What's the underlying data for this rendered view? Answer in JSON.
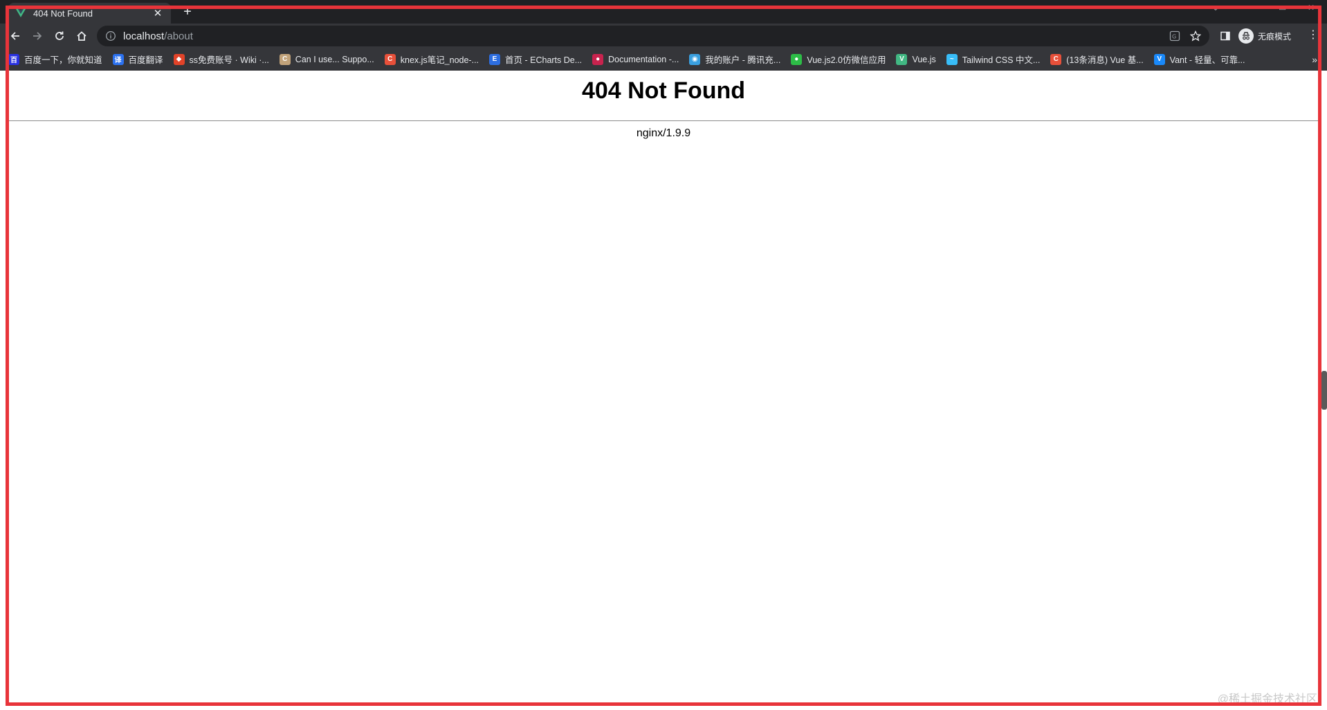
{
  "browser": {
    "tab": {
      "title": "404 Not Found",
      "close": "✕"
    },
    "new_tab": "+",
    "address": {
      "host": "localhost",
      "path": "/about"
    },
    "profile_label": "无痕模式",
    "menu": "⋮",
    "bookmarks_more": "»"
  },
  "bookmarks": [
    {
      "label": "百度一下，你就知道",
      "color": "#2932e1",
      "glyph": "百"
    },
    {
      "label": "百度翻译",
      "color": "#2b71f0",
      "glyph": "译"
    },
    {
      "label": "ss免费账号 · Wiki ·...",
      "color": "#e24329",
      "glyph": "◆"
    },
    {
      "label": "Can I use... Suppo...",
      "color": "#c2a37a",
      "glyph": "C"
    },
    {
      "label": "knex.js笔记_node-...",
      "color": "#e8503a",
      "glyph": "C"
    },
    {
      "label": "首页 - ECharts De...",
      "color": "#2d6ee0",
      "glyph": "E"
    },
    {
      "label": "Documentation -...",
      "color": "#c8234e",
      "glyph": "●"
    },
    {
      "label": "我的账户 - 腾讯充...",
      "color": "#3aa0e0",
      "glyph": "◉"
    },
    {
      "label": "Vue.js2.0仿微信应用",
      "color": "#2dbd47",
      "glyph": "●"
    },
    {
      "label": "Vue.js",
      "color": "#41b883",
      "glyph": "V"
    },
    {
      "label": "Tailwind CSS 中文...",
      "color": "#38bdf8",
      "glyph": "~"
    },
    {
      "label": "(13条消息) Vue 基...",
      "color": "#e8503a",
      "glyph": "C"
    },
    {
      "label": "Vant - 轻量、可靠...",
      "color": "#1989fa",
      "glyph": "V"
    }
  ],
  "page": {
    "title": "404 Not Found",
    "server": "nginx/1.9.9"
  },
  "watermark": "@稀土掘金技术社区"
}
